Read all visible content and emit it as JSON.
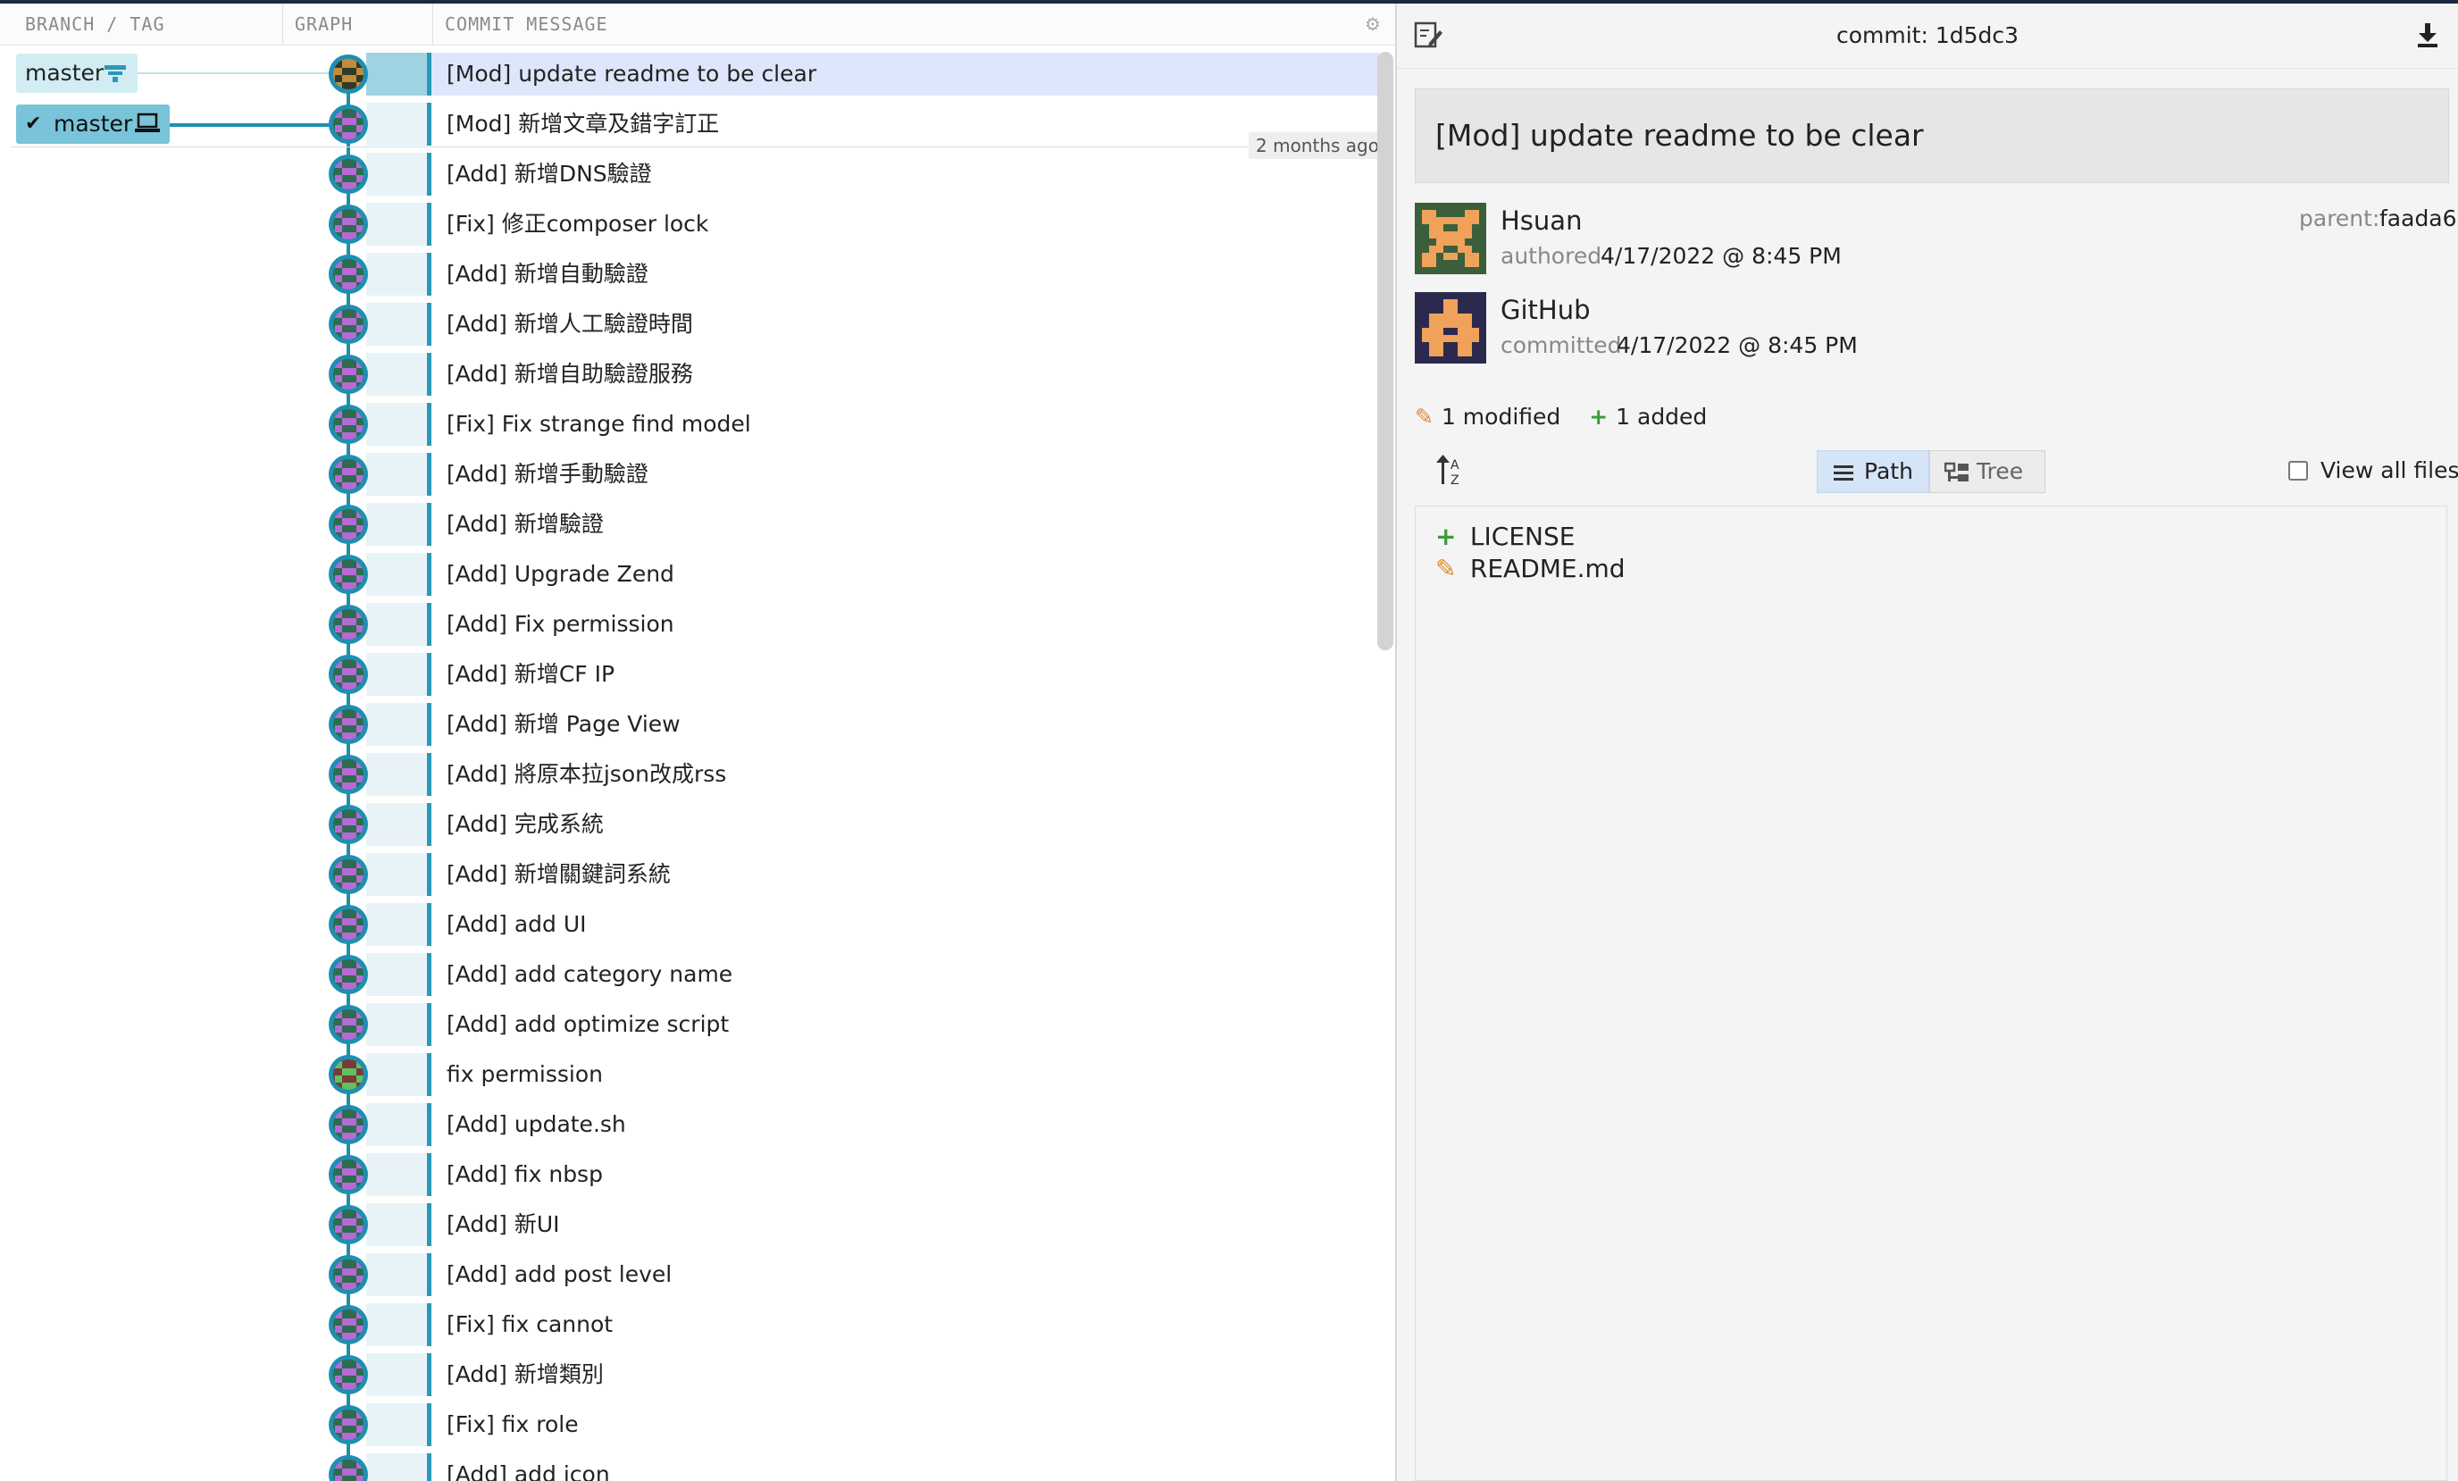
{
  "columns": {
    "branch": "BRANCH / TAG",
    "graph": "GRAPH",
    "message": "COMMIT MESSAGE"
  },
  "branches": {
    "remote": "master",
    "local": "master"
  },
  "time_badge": "2 months ago",
  "commits": [
    "[Mod] update readme to be clear",
    "[Mod] 新增文章及錯字訂正",
    "[Add] 新增DNS驗證",
    "[Fix] 修正composer lock",
    "[Add] 新增自動驗證",
    "[Add] 新增人工驗證時間",
    "[Add] 新增自助驗證服務",
    "[Fix] Fix strange find model",
    "[Add] 新增手動驗證",
    "[Add] 新增驗證",
    "[Add] Upgrade Zend",
    "[Add] Fix permission",
    "[Add] 新增CF IP",
    "[Add] 新增 Page View",
    "[Add] 將原本拉json改成rss",
    "[Add] 完成系統",
    "[Add] 新增關鍵詞系統",
    "[Add] add UI",
    "[Add] add category name",
    "[Add] add optimize script",
    "fix permission",
    "[Add] update.sh",
    "[Add] fix nbsp",
    "[Add] 新UI",
    "[Add] add post level",
    "[Fix] fix cannot",
    "[Add] 新增類別",
    "[Fix] fix role",
    "[Add] add icon"
  ],
  "detail": {
    "commit_prefix": "commit:",
    "commit_hash": "1d5dc3",
    "summary": "[Mod] update readme to be clear",
    "author": {
      "name": "Hsuan",
      "role": "authored",
      "date": "4/17/2022 @ 8:45 PM"
    },
    "committer": {
      "name": "GitHub",
      "role": "committed",
      "date": "4/17/2022 @ 8:45 PM"
    },
    "parent_label": "parent:",
    "parent_hash": "faada6",
    "modified": "1 modified",
    "added": "1 added",
    "view_path": "Path",
    "view_tree": "Tree",
    "view_all_files": "View all files",
    "files": [
      {
        "name": "LICENSE",
        "status": "added"
      },
      {
        "name": "README.md",
        "status": "modified"
      }
    ]
  },
  "colors": {
    "accent": "#2a99b8",
    "selected_row": "#dde6fb",
    "added": "#3a9a3a",
    "modified": "#d98c2b"
  },
  "icons": [
    "gear-icon",
    "remote-branch-icon",
    "checkmark-icon",
    "laptop-icon",
    "edit-commit-icon",
    "download-icon",
    "pencil-icon",
    "plus-icon",
    "sort-alpha-icon",
    "list-icon",
    "tree-icon"
  ]
}
